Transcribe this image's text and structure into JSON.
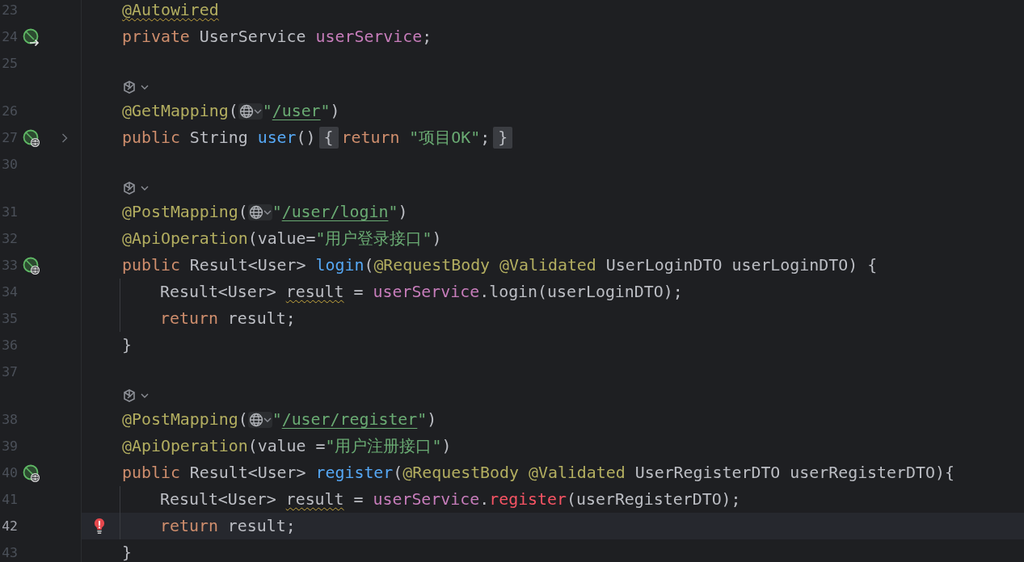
{
  "editor": {
    "lines": [
      {
        "kind": "code",
        "number": "23",
        "indented": false,
        "current": false,
        "tokens": [
          {
            "text": "@Autowired",
            "kind": "annotation",
            "warned": true
          }
        ]
      },
      {
        "kind": "code",
        "number": "24",
        "indented": false,
        "current": false,
        "gutter": {
          "kind": "bean-inject"
        },
        "tokens": [
          {
            "text": "private ",
            "kind": "keyword"
          },
          {
            "text": "UserService ",
            "kind": "plain"
          },
          {
            "text": "userService",
            "kind": "field"
          },
          {
            "text": ";",
            "kind": "plain"
          }
        ]
      },
      {
        "kind": "code",
        "number": "25",
        "indented": false,
        "current": false
      },
      {
        "kind": "inlay"
      },
      {
        "kind": "code",
        "number": "26",
        "indented": false,
        "current": false,
        "tokens": [
          {
            "text": "@GetMapping",
            "kind": "annotation"
          },
          {
            "text": "(",
            "kind": "plain"
          },
          {
            "kind": "url-hint"
          },
          {
            "text": "\"",
            "kind": "string"
          },
          {
            "text": "/user",
            "kind": "url"
          },
          {
            "text": "\"",
            "kind": "string"
          },
          {
            "text": ")",
            "kind": "plain"
          }
        ]
      },
      {
        "kind": "code",
        "number": "27",
        "indented": false,
        "current": false,
        "gutter": {
          "kind": "bean-endpoint"
        },
        "folded": true,
        "tokens": [
          {
            "text": "public ",
            "kind": "keyword"
          },
          {
            "text": "String ",
            "kind": "plain"
          },
          {
            "text": "user",
            "kind": "method"
          },
          {
            "text": "()",
            "kind": "plain"
          },
          {
            "text": "{",
            "kind": "fold"
          },
          {
            "text": "return ",
            "kind": "keyword"
          },
          {
            "text": "\"项目OK\"",
            "kind": "string"
          },
          {
            "text": ";",
            "kind": "plain"
          },
          {
            "text": "}",
            "kind": "fold"
          }
        ]
      },
      {
        "kind": "code",
        "number": "30",
        "indented": false,
        "current": false
      },
      {
        "kind": "inlay"
      },
      {
        "kind": "code",
        "number": "31",
        "indented": false,
        "current": false,
        "tokens": [
          {
            "text": "@PostMapping",
            "kind": "annotation"
          },
          {
            "text": "(",
            "kind": "plain"
          },
          {
            "kind": "url-hint"
          },
          {
            "text": "\"",
            "kind": "string"
          },
          {
            "text": "/user/login",
            "kind": "url"
          },
          {
            "text": "\"",
            "kind": "string"
          },
          {
            "text": ")",
            "kind": "plain"
          }
        ]
      },
      {
        "kind": "code",
        "number": "32",
        "indented": false,
        "current": false,
        "tokens": [
          {
            "text": "@ApiOperation",
            "kind": "annotation"
          },
          {
            "text": "(value=",
            "kind": "plain"
          },
          {
            "text": "\"用户登录接口\"",
            "kind": "string"
          },
          {
            "text": ")",
            "kind": "plain"
          }
        ]
      },
      {
        "kind": "code",
        "number": "33",
        "indented": false,
        "current": false,
        "gutter": {
          "kind": "bean-endpoint"
        },
        "tokens": [
          {
            "text": "public ",
            "kind": "keyword"
          },
          {
            "text": "Result<User> ",
            "kind": "plain"
          },
          {
            "text": "login",
            "kind": "method"
          },
          {
            "text": "(",
            "kind": "plain"
          },
          {
            "text": "@RequestBody @Validated ",
            "kind": "annotation"
          },
          {
            "text": "UserLoginDTO userLoginDTO) {",
            "kind": "plain"
          }
        ]
      },
      {
        "kind": "code",
        "number": "34",
        "indented": true,
        "current": false,
        "tokens": [
          {
            "text": "Result<User> ",
            "kind": "plain"
          },
          {
            "text": "result",
            "kind": "plain",
            "warned": true
          },
          {
            "text": " = ",
            "kind": "plain"
          },
          {
            "text": "userService",
            "kind": "field"
          },
          {
            "text": ".login(userLoginDTO);",
            "kind": "plain"
          }
        ]
      },
      {
        "kind": "code",
        "number": "35",
        "indented": true,
        "current": false,
        "tokens": [
          {
            "text": "return ",
            "kind": "keyword"
          },
          {
            "text": "result;",
            "kind": "plain"
          }
        ]
      },
      {
        "kind": "code",
        "number": "36",
        "indented": false,
        "current": false,
        "tokens": [
          {
            "text": "}",
            "kind": "plain"
          }
        ]
      },
      {
        "kind": "code",
        "number": "37",
        "indented": false,
        "current": false
      },
      {
        "kind": "inlay"
      },
      {
        "kind": "code",
        "number": "38",
        "indented": false,
        "current": false,
        "tokens": [
          {
            "text": "@PostMapping",
            "kind": "annotation"
          },
          {
            "text": "(",
            "kind": "plain"
          },
          {
            "kind": "url-hint"
          },
          {
            "text": "\"",
            "kind": "string"
          },
          {
            "text": "/user/register",
            "kind": "url"
          },
          {
            "text": "\"",
            "kind": "string"
          },
          {
            "text": ")",
            "kind": "plain"
          }
        ]
      },
      {
        "kind": "code",
        "number": "39",
        "indented": false,
        "current": false,
        "tokens": [
          {
            "text": "@ApiOperation",
            "kind": "annotation"
          },
          {
            "text": "(value =",
            "kind": "plain"
          },
          {
            "text": "\"用户注册接口\"",
            "kind": "string"
          },
          {
            "text": ")",
            "kind": "plain"
          }
        ]
      },
      {
        "kind": "code",
        "number": "40",
        "indented": false,
        "current": false,
        "gutter": {
          "kind": "bean-endpoint"
        },
        "tokens": [
          {
            "text": "public ",
            "kind": "keyword"
          },
          {
            "text": "Result<User> ",
            "kind": "plain"
          },
          {
            "text": "register",
            "kind": "method"
          },
          {
            "text": "(",
            "kind": "plain"
          },
          {
            "text": "@RequestBody @Validated ",
            "kind": "annotation"
          },
          {
            "text": "UserRegisterDTO userRegisterDTO){",
            "kind": "plain"
          }
        ]
      },
      {
        "kind": "code",
        "number": "41",
        "indented": true,
        "current": false,
        "tokens": [
          {
            "text": "Result<User> ",
            "kind": "plain"
          },
          {
            "text": "result",
            "kind": "plain",
            "warned": true
          },
          {
            "text": " = ",
            "kind": "plain"
          },
          {
            "text": "userService",
            "kind": "field"
          },
          {
            "text": ".",
            "kind": "plain"
          },
          {
            "text": "register",
            "kind": "error"
          },
          {
            "text": "(userRegisterDTO);",
            "kind": "plain"
          }
        ]
      },
      {
        "kind": "code",
        "number": "42",
        "indented": true,
        "current": true,
        "marker": {
          "kind": "error-bulb"
        },
        "tokens": [
          {
            "text": "return ",
            "kind": "keyword"
          },
          {
            "text": "result;",
            "kind": "plain"
          }
        ]
      },
      {
        "kind": "code",
        "number": "43",
        "indented": false,
        "current": false,
        "tokens": [
          {
            "text": "}",
            "kind": "plain"
          }
        ]
      }
    ]
  }
}
